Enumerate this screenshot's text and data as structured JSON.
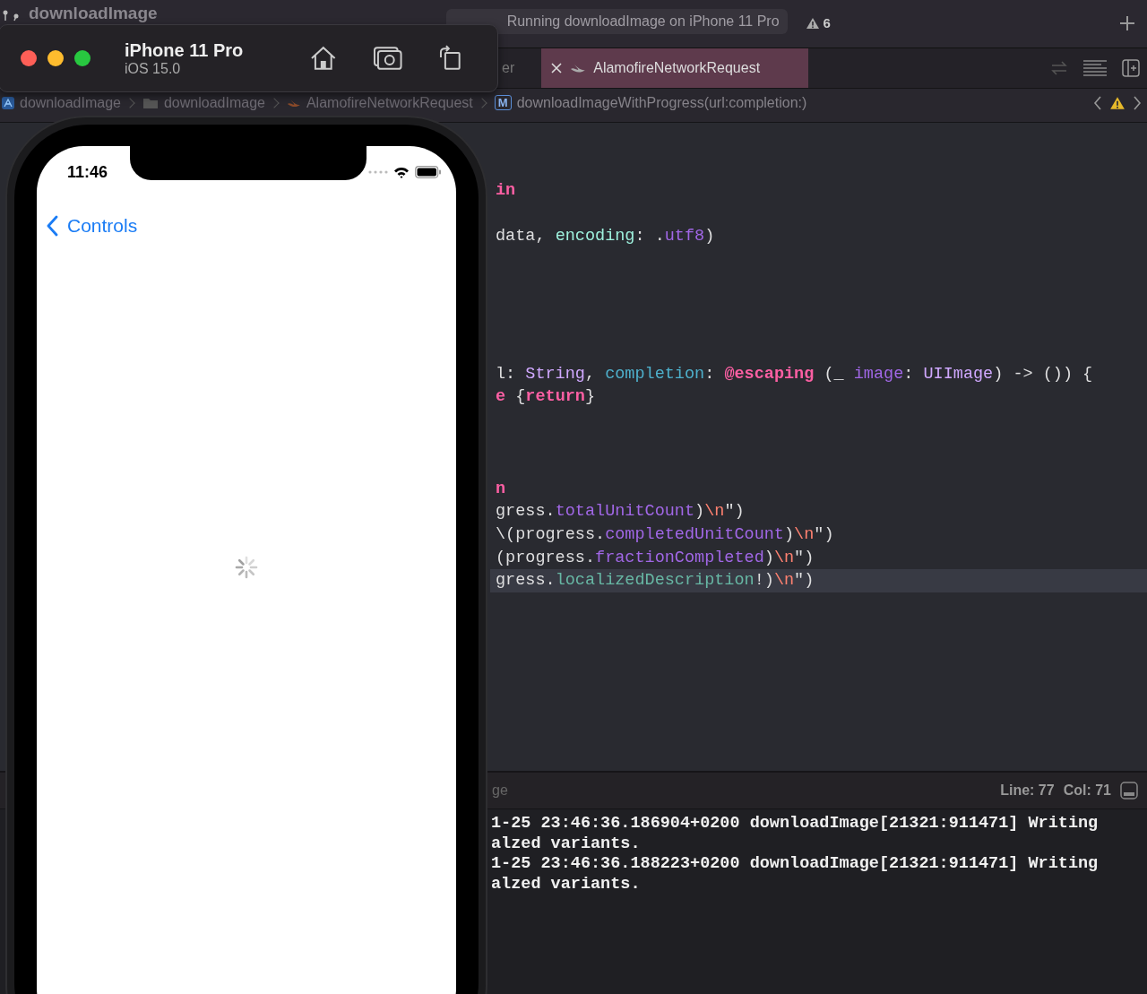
{
  "app_title": "downloadImage",
  "activity": {
    "status": "Running downloadImage on iPhone 11 Pro",
    "warnings": "6"
  },
  "tabs": [
    {
      "label": "er",
      "selected": false
    },
    {
      "label": "AlamofireNetworkRequest",
      "selected": true
    }
  ],
  "jump_bar": [
    {
      "label": "downloadImage",
      "kind": "project"
    },
    {
      "label": "downloadImage",
      "kind": "folder"
    },
    {
      "label": "AlamofireNetworkRequest",
      "kind": "swift"
    },
    {
      "label": "downloadImageWithProgress(url:completion:)",
      "kind": "method",
      "badge": "M"
    }
  ],
  "editor": {
    "lines": [
      {
        "current": false,
        "tokens": [
          {
            "t": "in",
            "kind": "keyword"
          }
        ]
      },
      {
        "current": false,
        "tokens": [
          {
            "t": "data, ",
            "kind": "plain"
          },
          {
            "t": "encoding",
            "kind": "label"
          },
          {
            "t": ": .",
            "kind": "plain"
          },
          {
            "t": "utf8",
            "kind": "member"
          },
          {
            "t": ")",
            "kind": "plain"
          }
        ]
      },
      {
        "current": false,
        "tokens": [
          {
            "t": "l: ",
            "kind": "plain"
          },
          {
            "t": "String",
            "kind": "type"
          },
          {
            "t": ", ",
            "kind": "plain"
          },
          {
            "t": "completion",
            "kind": "parameter"
          },
          {
            "t": ": ",
            "kind": "plain"
          },
          {
            "t": "@escaping",
            "kind": "keyword"
          },
          {
            "t": " (_ ",
            "kind": "plain"
          },
          {
            "t": "image",
            "kind": "member"
          },
          {
            "t": ": ",
            "kind": "plain"
          },
          {
            "t": "UIImage",
            "kind": "type"
          },
          {
            "t": ") -> ()) {",
            "kind": "plain"
          }
        ]
      },
      {
        "current": false,
        "tokens": [
          {
            "t": "e",
            "kind": "keyword"
          },
          {
            "t": " {",
            "kind": "plain"
          },
          {
            "t": "return",
            "kind": "keyword"
          },
          {
            "t": "}",
            "kind": "plain"
          }
        ]
      },
      {
        "current": false,
        "tokens": [
          {
            "t": "n",
            "kind": "keyword"
          }
        ]
      },
      {
        "current": false,
        "tokens": [
          {
            "t": "gress.",
            "kind": "plain"
          },
          {
            "t": "totalUnitCount",
            "kind": "member"
          },
          {
            "t": ")",
            "kind": "plain"
          },
          {
            "t": "\\n",
            "kind": "escape"
          },
          {
            "t": "\")",
            "kind": "plain"
          }
        ]
      },
      {
        "current": false,
        "tokens": [
          {
            "t": "\\(progress.",
            "kind": "plain"
          },
          {
            "t": "completedUnitCount",
            "kind": "member"
          },
          {
            "t": ")",
            "kind": "plain"
          },
          {
            "t": "\\n",
            "kind": "escape"
          },
          {
            "t": "\")",
            "kind": "plain"
          }
        ]
      },
      {
        "current": false,
        "tokens": [
          {
            "t": "(progress.",
            "kind": "plain"
          },
          {
            "t": "fractionCompleted",
            "kind": "member"
          },
          {
            "t": ")",
            "kind": "plain"
          },
          {
            "t": "\\n",
            "kind": "escape"
          },
          {
            "t": "\")",
            "kind": "plain"
          }
        ]
      },
      {
        "current": true,
        "tokens": [
          {
            "t": "gress.",
            "kind": "plain"
          },
          {
            "t": "localizedDescription",
            "kind": "system"
          },
          {
            "t": "!)",
            "kind": "plain"
          },
          {
            "t": "\\n",
            "kind": "escape"
          },
          {
            "t": "\")",
            "kind": "plain"
          }
        ]
      }
    ]
  },
  "debug_bar": {
    "filter": "ge",
    "line": "Line: 77",
    "col": "Col: 71"
  },
  "console": [
    "1-25 23:46:36.186904+0200 downloadImage[21321:911471] Writing",
    "alzed variants.",
    "1-25 23:46:36.188223+0200 downloadImage[21321:911471] Writing",
    "alzed variants."
  ],
  "simulator": {
    "device": "iPhone 11 Pro",
    "os": "iOS 15.0",
    "time": "11:46",
    "back_label": "Controls",
    "loading": true
  }
}
